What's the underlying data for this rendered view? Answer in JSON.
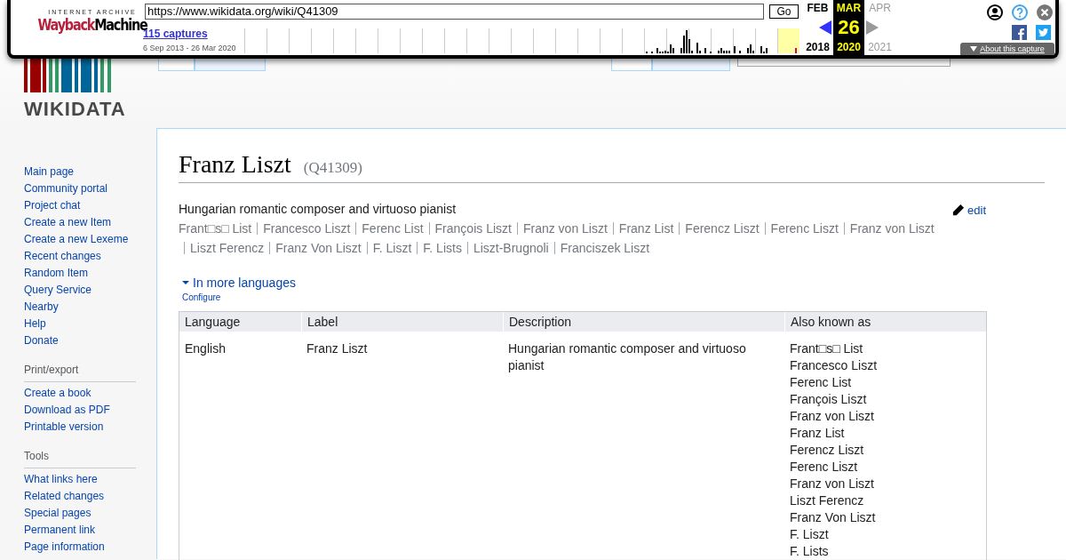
{
  "wayback": {
    "logo_top": "INTERNET ARCHIVE",
    "logo_parts": [
      "Wayback",
      "Machine"
    ],
    "url": "https://www.wikidata.org/wiki/Q41309",
    "go": "Go",
    "captures": "115 captures",
    "range": "6 Sep 2013 - 26 Mar 2020",
    "months": [
      {
        "month": "FEB",
        "year": "2018",
        "selected": false,
        "available": true
      },
      {
        "month": "MAR",
        "day": "26",
        "year": "2020",
        "selected": true
      },
      {
        "month": "APR",
        "year": "2021",
        "selected": false,
        "available": false
      }
    ],
    "about": "About this capture"
  },
  "header": {
    "logo_text": "WIKIDATA",
    "left_tabs": [
      {
        "selected": true
      },
      {
        "selected": false
      }
    ],
    "right_tabs": [
      {
        "selected": true
      },
      {
        "selected": false
      }
    ]
  },
  "sidebar": {
    "sections": [
      {
        "items": [
          "Main page",
          "Community portal",
          "Project chat",
          "Create a new Item",
          "Create a new Lexeme",
          "Recent changes",
          "Random Item",
          "Query Service",
          "Nearby",
          "Help",
          "Donate"
        ]
      },
      {
        "heading": "Print/export",
        "items": [
          "Create a book",
          "Download as PDF",
          "Printable version"
        ]
      },
      {
        "heading": "Tools",
        "items": [
          "What links here",
          "Related changes",
          "Special pages",
          "Permanent link",
          "Page information"
        ]
      }
    ]
  },
  "page": {
    "title": "Franz Liszt",
    "id": "(Q41309)",
    "description": "Hungarian romantic composer and virtuoso pianist",
    "edit": "edit",
    "aliases": [
      "Frant□s□ List",
      "Francesco Liszt",
      "Ferenc List",
      "François Liszt",
      "Franz von Liszt",
      "Franz List",
      "Ferencz Liszt",
      "Ferenc Liszt",
      "Franz von Liszt",
      "Liszt Ferencz",
      "Franz Von Liszt",
      "F. Liszt",
      "F. Lists",
      "Liszt-Brugnoli",
      "Franciszek Liszt"
    ],
    "more_languages": "In more languages",
    "expanded": true,
    "configure": "Configure",
    "table": {
      "columns": [
        "Language",
        "Label",
        "Description",
        "Also known as"
      ],
      "rows": [
        {
          "language": "English",
          "label": "Franz Liszt",
          "description": "Hungarian romantic composer and virtuoso pianist",
          "also_known_as": [
            "Frant□s□ List",
            "Francesco Liszt",
            "Ferenc List",
            "François Liszt",
            "Franz von Liszt",
            "Franz List",
            "Ferencz Liszt",
            "Ferenc Liszt",
            "Franz von Liszt",
            "Liszt Ferencz",
            "Franz Von Liszt",
            "F. Liszt",
            "F. Lists"
          ]
        }
      ]
    }
  }
}
